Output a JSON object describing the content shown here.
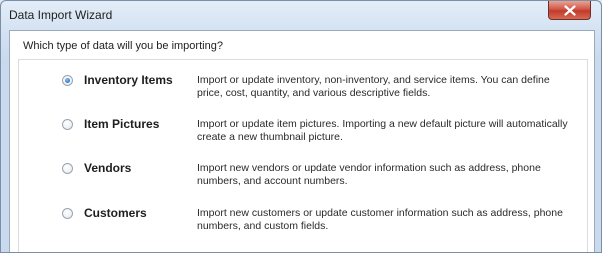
{
  "window": {
    "title": "Data Import Wizard",
    "close_icon": "close-icon"
  },
  "prompt": {
    "question": "Which type of data will you be importing?"
  },
  "options": [
    {
      "label": "Inventory Items",
      "description": "Import or update inventory, non-inventory, and service items. You can define price, cost, quantity, and various descriptive fields.",
      "selected": true
    },
    {
      "label": "Item Pictures",
      "description": "Import or update item pictures. Importing a new default picture will automatically create a new thumbnail picture.",
      "selected": false
    },
    {
      "label": "Vendors",
      "description": "Import new vendors or update vendor information such as address, phone numbers, and account numbers.",
      "selected": false
    },
    {
      "label": "Customers",
      "description": "Import new customers or update customer information such as address, phone numbers, and custom fields.",
      "selected": false
    }
  ],
  "colors": {
    "close_button": "#c13a2c",
    "radio_selected": "#2a78c9"
  }
}
